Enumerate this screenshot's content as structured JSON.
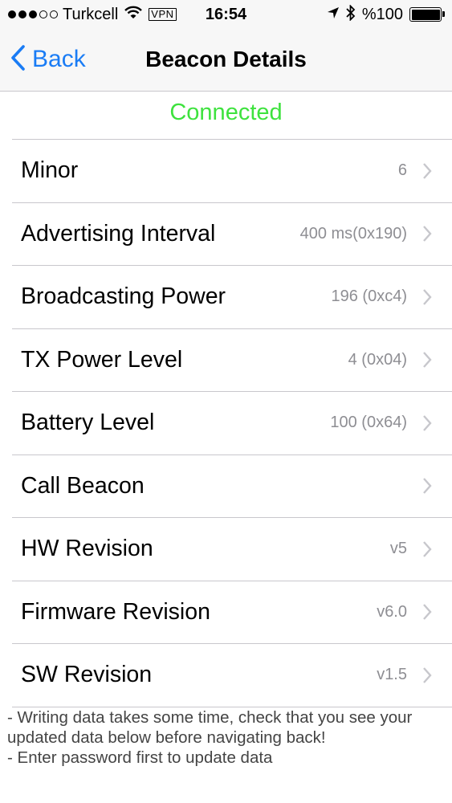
{
  "status_bar": {
    "carrier": "Turkcell",
    "vpn": "VPN",
    "time": "16:54",
    "battery": "%100",
    "signal_bars_filled": 3,
    "signal_bars_total": 5
  },
  "nav": {
    "back_label": "Back",
    "title": "Beacon Details"
  },
  "connection_status": "Connected",
  "colors": {
    "accent": "#1a7cf5",
    "connected": "#3ee23e",
    "value_text": "#8e8e93"
  },
  "rows": [
    {
      "label": "Minor",
      "value": "6"
    },
    {
      "label": "Advertising Interval",
      "value": "400 ms(0x190)"
    },
    {
      "label": "Broadcasting Power",
      "value": "196 (0xc4)"
    },
    {
      "label": "TX Power Level",
      "value": "4 (0x04)"
    },
    {
      "label": "Battery Level",
      "value": "100 (0x64)"
    },
    {
      "label": "Call Beacon",
      "value": ""
    },
    {
      "label": "HW Revision",
      "value": "v5"
    },
    {
      "label": "Firmware Revision",
      "value": "v6.0"
    },
    {
      "label": "SW Revision",
      "value": "v1.5"
    }
  ],
  "footer": {
    "line1": "- Writing data takes some time, check that you see your updated data below before navigating back!",
    "line2": "- Enter password first to update data"
  }
}
